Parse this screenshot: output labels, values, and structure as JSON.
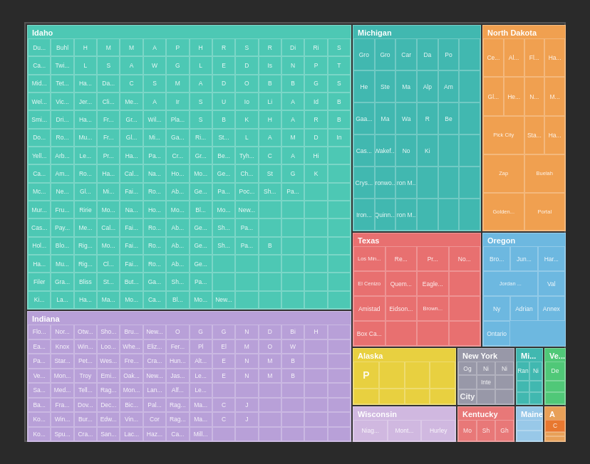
{
  "regions": {
    "idaho": {
      "label": "Idaho",
      "color": "#4dc8b4",
      "cells": [
        "Du...",
        "Buhl",
        "H",
        "M",
        "M",
        "A",
        "P",
        "H",
        "R",
        "S",
        "R",
        "Di",
        "Ri",
        "S",
        "Ca...",
        "Twi...",
        "M",
        "G",
        "L",
        "E",
        "D",
        "Is",
        "N",
        "P",
        "T",
        "A",
        "St",
        "O",
        "Mid...",
        "Tet...",
        "Ha...",
        "Da...",
        "C",
        "S",
        "M",
        "A",
        "D",
        "O",
        "B",
        "B",
        "G",
        "S",
        "Wel...",
        "Vic...",
        "Jer...",
        "Cli...",
        "Me...",
        "A",
        "Ir",
        "S",
        "U",
        "Io",
        "Li",
        "A",
        "Id",
        "B",
        "Smi...",
        "Dri...",
        "Ha...",
        "Fr...",
        "Gre...",
        "Wil...",
        "Pla...",
        "S",
        "B",
        "K",
        "H",
        "A",
        "R",
        "B",
        "Do...",
        "Ro...",
        "Mu...",
        "Fr...",
        "Gre...",
        "Mi...",
        "Ga...",
        "Ri...",
        "St...",
        "L",
        "A",
        "M",
        "D",
        "In",
        "Yell...",
        "Arb...",
        "Le...",
        "Pr...",
        "Ha...",
        "Pa...",
        "Cr...",
        "Gr...",
        "Be...",
        "Mo...",
        "Bl...",
        "Tyh...",
        "C",
        "A",
        "Ca...",
        "Am...",
        "Ro...",
        "Ha...",
        "Cal...",
        "Na...",
        "Ho...",
        "Mo...",
        "Ge...",
        "Ch...",
        "St",
        "G",
        "K",
        "Mc...",
        "Ne...",
        "Gl...",
        "Mi...",
        "Fai...",
        "Ro...",
        "Ab...",
        "Ge...",
        "Pa...",
        "Poc...",
        "Sh...",
        "Pa...",
        "Mur...",
        "Fru...",
        "Ririe",
        "Mo...",
        "Na...",
        "Ho...",
        "Mo...",
        "Bl...",
        "Mo...",
        "New...",
        "Cas...",
        "Pay...",
        "Me...",
        "Cal...",
        "Na...",
        "Ho...",
        "Mo...",
        "Bl...",
        "Mo...",
        "New...",
        "Hol...",
        "Blo...",
        "Rig...",
        "Mo...",
        "Fai...",
        "Ro...",
        "Ab...",
        "Ge...",
        "Sh...",
        "Pa...",
        "B",
        "Ha...",
        "Mu...",
        "Rig...",
        "Cl...",
        "Fai...",
        "Ro...",
        "Ab...",
        "Ge...",
        "Filer",
        "Gra...",
        "Bliss",
        "St...",
        "But...",
        "Ga...",
        "Sh...",
        "Pa...",
        "Ki...",
        "La...",
        "Ha...",
        "Ma...",
        "Mo...",
        "Ca...",
        "Bl...",
        "Mo...",
        "New..."
      ]
    },
    "michigan": {
      "label": "Michigan",
      "color": "#41b8b0",
      "cells": [
        "Gro",
        "Gro",
        "Car",
        "Da",
        "Po",
        "He",
        "Ste",
        "Ma",
        "Alp",
        "Am",
        "Gaa...",
        "Ma",
        "Wa",
        "R",
        "Be",
        "Cas...",
        "Wakef...",
        "No",
        "Ki",
        "Crys...",
        "Ironwo...",
        "Iron M...",
        "Iron...",
        "Quinn..."
      ]
    },
    "north_dakota": {
      "label": "North Dakota",
      "color": "#f0a050",
      "cells": [
        "Ce...",
        "Al...",
        "Fl...",
        "Ha...",
        "Gl...",
        "He...",
        "N...",
        "M...",
        "Pick City",
        "Sta...",
        "Ha...",
        "Zap",
        "Beulah",
        "Golden...",
        "Portal"
      ]
    },
    "texas": {
      "label": "Texas",
      "color": "#e87070",
      "cells": [
        "Los Min...",
        "Re...",
        "Pr...",
        "No...",
        "El Cenizo",
        "Quem...",
        "Eagle ...",
        "Amistad",
        "Eidson...",
        "Brown...",
        "Box Ca..."
      ]
    },
    "oregon": {
      "label": "Oregon",
      "color": "#6db8e0",
      "cells": [
        "Bro...",
        "Jun...",
        "Har...",
        "Jordan ...",
        "Val",
        "Ny",
        "Adrian",
        "Annex",
        "Ontario"
      ]
    },
    "indiana": {
      "label": "Indiana",
      "color": "#b8a0d8",
      "cells": [
        "Flo...",
        "Nor...",
        "Otw...",
        "Sho...",
        "Bru...",
        "New...",
        "O",
        "G",
        "G",
        "N",
        "D",
        "Bi",
        "H",
        "Ea...",
        "Knox",
        "Win...",
        "Loo...",
        "Whe...",
        "Eliz...",
        "Fer...",
        "Pl",
        "El",
        "M",
        "O",
        "W",
        "Pa...",
        "Star...",
        "Pet...",
        "Wes...",
        "Fre...",
        "Cra...",
        "Hun...",
        "Alt...",
        "E",
        "N",
        "M",
        "B",
        "Ve...",
        "Mon...",
        "Troy",
        "Emi...",
        "Oak...",
        "New...",
        "Jas...",
        "Le...",
        "E",
        "N",
        "M",
        "B",
        "Sa...",
        "Med...",
        "Tell...",
        "Rag...",
        "Mon...",
        "Lan...",
        "Alf...",
        "Le...",
        "Ba...",
        "Fra...",
        "Dov...",
        "Dec...",
        "Bic...",
        "Pal...",
        "Rag...",
        "Ma...",
        "C",
        "J",
        "Ko...",
        "Win...",
        "Bur...",
        "Edw...",
        "Vin...",
        "Cor",
        "Rag...",
        "Ma...",
        "C",
        "J",
        "Ko...",
        "Spu...",
        "Cra...",
        "San...",
        "Lac...",
        "Haz...",
        "Ca...",
        "Mill..."
      ]
    },
    "alaska": {
      "label": "Alaska",
      "color": "#e8d040",
      "cells": [
        "P",
        "",
        "",
        "",
        "",
        "",
        "",
        "",
        "",
        "",
        "",
        ""
      ]
    },
    "new_york": {
      "label": "New York",
      "color": "#9898a8",
      "cells": [
        "Og",
        "Ni",
        "Ni",
        "",
        "Inte",
        "",
        ""
      ]
    },
    "wisconsin": {
      "label": "Wisconsin",
      "color": "#d0b8e0",
      "cells": [
        "Niag...",
        "Mont...",
        "Hurley"
      ]
    },
    "kentucky": {
      "label": "Kentucky",
      "color": "#e87878",
      "cells": [
        "Mo",
        "Sh",
        "Gh"
      ]
    },
    "maine": {
      "label": "Maine",
      "color": "#98c8e8",
      "cells": [
        ""
      ]
    },
    "city_label": "City"
  }
}
